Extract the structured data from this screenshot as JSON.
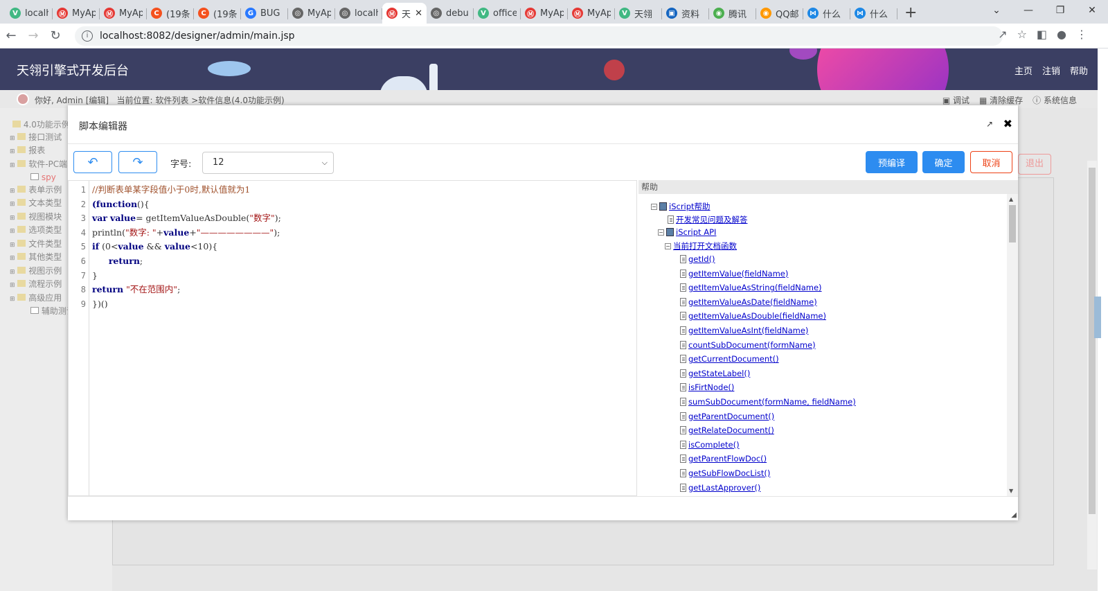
{
  "browser": {
    "tabs": [
      {
        "title": "localh",
        "color": "#41b883",
        "glyph": "V"
      },
      {
        "title": "MyAp",
        "color": "#e53935",
        "glyph": "Ⓜ"
      },
      {
        "title": "MyAp",
        "color": "#e53935",
        "glyph": "Ⓜ"
      },
      {
        "title": "(19条",
        "color": "#f4511e",
        "glyph": "C"
      },
      {
        "title": "(19条",
        "color": "#f4511e",
        "glyph": "C"
      },
      {
        "title": "BUG",
        "color": "#2979ff",
        "glyph": "G"
      },
      {
        "title": "MyAp",
        "color": "#666",
        "glyph": "◎"
      },
      {
        "title": "localh",
        "color": "#666",
        "glyph": "◎"
      },
      {
        "title": "天",
        "color": "#e53935",
        "glyph": "Ⓜ",
        "active": true
      },
      {
        "title": "debu",
        "color": "#666",
        "glyph": "◎"
      },
      {
        "title": "office",
        "color": "#41b883",
        "glyph": "V"
      },
      {
        "title": "MyAp",
        "color": "#e53935",
        "glyph": "Ⓜ"
      },
      {
        "title": "MyAp",
        "color": "#e53935",
        "glyph": "Ⓜ"
      },
      {
        "title": "天翎",
        "color": "#41b883",
        "glyph": "V"
      },
      {
        "title": "资料",
        "color": "#1565c0",
        "glyph": "▣"
      },
      {
        "title": "腾讯",
        "color": "#4caf50",
        "glyph": "◉"
      },
      {
        "title": "QQ邮",
        "color": "#ff9800",
        "glyph": "◉"
      },
      {
        "title": "什么",
        "color": "#1e88e5",
        "glyph": "⋈"
      },
      {
        "title": "什么",
        "color": "#1e88e5",
        "glyph": "⋈"
      }
    ],
    "url": "localhost:8082/designer/admin/main.jsp"
  },
  "app": {
    "brand": "天翎引擎式开发后台",
    "links": [
      "主页",
      "注销",
      "帮助"
    ],
    "greeting": "你好, Admin [编辑]",
    "location": "当前位置: 软件列表 >软件信息(4.0功能示例)",
    "tools": [
      "调试",
      "清除缓存",
      "系统信息"
    ],
    "tree": [
      "4.0功能示例",
      "接口测试",
      "报表",
      "软件-PC端",
      "spy",
      "表单示例",
      "文本类型",
      "视图模块",
      "选项类型",
      "文件类型",
      "其他类型",
      "视图示例",
      "流程示例",
      "高级应用",
      "辅助测试"
    ],
    "exit": "退出"
  },
  "modal": {
    "title": "脚本编辑器",
    "font_label": "字号:",
    "font_size": "12",
    "precompile": "预编译",
    "confirm": "确定",
    "cancel": "取消",
    "help_title": "帮助"
  },
  "code_lines": [
    "1",
    "2",
    "3",
    "4",
    "5",
    "6",
    "7",
    "8",
    "9"
  ],
  "help": {
    "root": "iScript帮助",
    "faq": "开发常见问题及解答",
    "api": "iScript API",
    "current": "当前打开文档函数",
    "functions": [
      "getId()",
      "getItemValue(fieldName)",
      "getItemValueAsString(fieldName)",
      "getItemValueAsDate(fieldName)",
      "getItemValueAsDouble(fieldName)",
      "getItemValueAsInt(fieldName)",
      "countSubDocument(formName)",
      "getCurrentDocument()",
      "getStateLabel()",
      "isFirtNode()",
      "sumSubDocument(formName, fieldName)",
      "getParentDocument()",
      "getRelateDocument()",
      "isComplete()",
      "getParentFlowDoc()",
      "getSubFlowDocList()",
      "getLastApprover()"
    ]
  }
}
